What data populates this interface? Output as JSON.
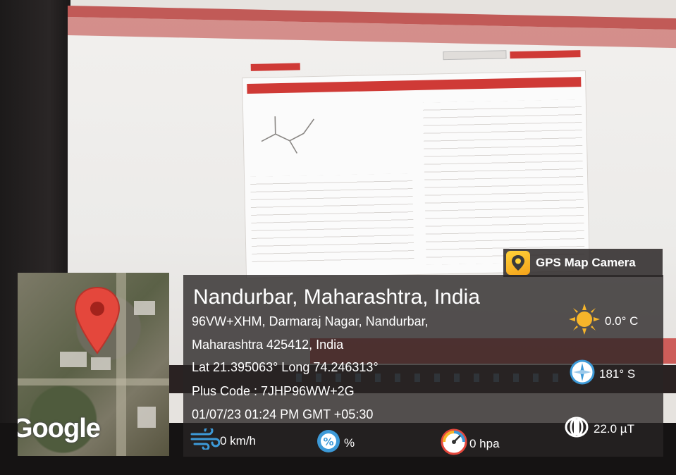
{
  "gps_tag": {
    "label": "GPS Map Camera"
  },
  "map": {
    "attribution": "Google"
  },
  "location": {
    "title": "Nandurbar, Maharashtra, India",
    "address_line1": "96VW+XHM, Darmaraj Nagar, Nandurbar,",
    "address_line2": "Maharashtra 425412, India",
    "coordinates": "Lat 21.395063° Long 74.246313°",
    "plus_code": "Plus Code : 7JHP96WW+2G",
    "datetime": "01/07/23 01:24 PM GMT +05:30"
  },
  "metrics": {
    "temperature": "0.0° C",
    "heading": "181° S",
    "magnetic_field": "22.0 µT",
    "wind": "0 km/h",
    "humidity": "%",
    "pressure": "0 hpa"
  },
  "colors": {
    "pin": "#e4473c",
    "overlay": "#2c2828",
    "sun": "#f7b52a",
    "accent_blue": "#3d9ad8"
  },
  "icons": [
    "gps-map-camera-logo-icon",
    "map-pin-icon",
    "sun-icon",
    "compass-icon",
    "magnet-icon",
    "wind-icon",
    "humidity-icon",
    "pressure-gauge-icon"
  ]
}
